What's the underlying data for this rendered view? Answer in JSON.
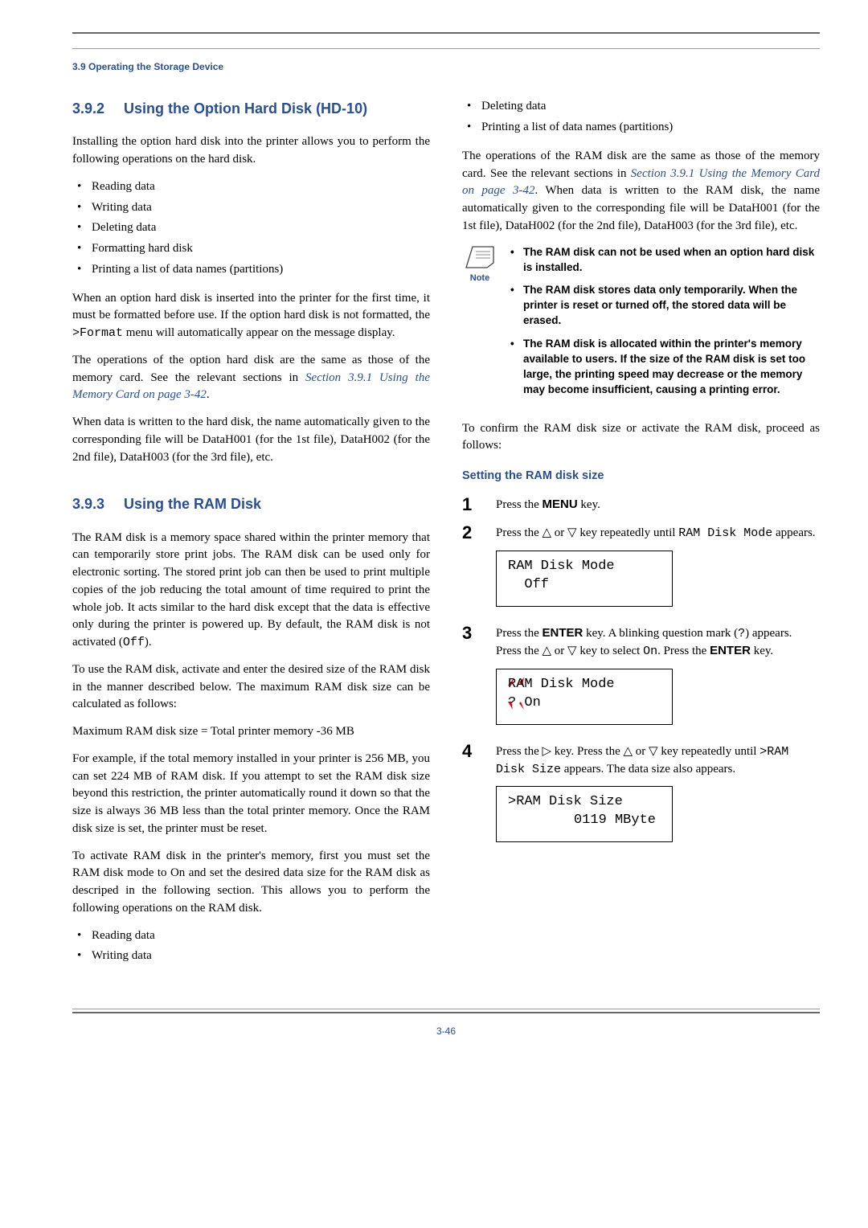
{
  "running_head": "3.9 Operating the Storage Device",
  "sect392": {
    "num": "3.9.2",
    "title": "Using the Option Hard Disk (HD-10)",
    "intro": "Installing the option hard disk into the printer allows you to perform the following operations on the hard disk.",
    "bullets": [
      "Reading data",
      "Writing data",
      "Deleting data",
      "Formatting hard disk",
      "Printing a list of data names (partitions)"
    ],
    "para2a": "When an option hard disk is inserted into the printer for the first time, it must be formatted before use. If the option hard disk is not formatted, the ",
    "format_code": ">Format",
    "para2b": " menu will automatically appear on the message display.",
    "para3a": "The operations of the option hard disk are the same as those of the memory card. See the relevant sections in ",
    "link1": "Section 3.9.1 Using the Memory Card on page 3-42",
    "para3b": ".",
    "para4": "When data is written to the hard disk, the name automatically given to the corresponding file will be DataH001 (for the 1st file), DataH002 (for the 2nd file), DataH003 (for the 3rd file), etc."
  },
  "sect393": {
    "num": "3.9.3",
    "title": "Using the RAM Disk",
    "para1a": "The RAM disk is a memory space shared within the printer memory that can temporarily store print jobs. The RAM disk can be used only for electronic sorting. The stored print job can then be used to print multiple copies of the job reducing the total amount of time required to print the whole job. It acts similar to the hard disk except that the data is effective only during the printer is powered up. By default, the RAM disk is not activated (",
    "off_code": "Off",
    "para1b": ").",
    "para2": "To use the RAM disk, activate and enter the desired size of the RAM disk in the manner described below. The maximum RAM disk size can be calculated as follows:",
    "formula": "Maximum RAM disk size = Total printer memory -36 MB",
    "para4": "For example, if the total memory installed in your printer is 256 MB, you can set 224 MB of RAM disk. If you attempt to set the RAM disk size beyond this restriction, the printer automatically round it down so that the size is always 36 MB less than the total printer memory. Once the RAM disk size is set, the printer must be reset.",
    "para5": "To activate RAM disk in the printer's memory, first you must set the RAM disk mode to On and set the desired data size for the RAM disk as descriped in the following section. This allows you to perform the following operations on the RAM disk.",
    "bullets2": [
      "Reading data",
      "Writing data"
    ]
  },
  "right": {
    "top_bullets": [
      "Deleting data",
      "Printing a list of data names (partitions)"
    ],
    "para1a": "The operations of the RAM disk are the same as those of the memory card. See the relevant sections in ",
    "link2": "Section 3.9.1 Using the Memory Card on page 3-42",
    "para1b": ". When data is written to the RAM disk, the name automatically given to the corresponding file will be DataH001 (for the 1st file), DataH002 (for the 2nd file), DataH003 (for the 3rd file), etc.",
    "note_label": "Note",
    "note_items": [
      "The RAM disk can not be used when an option hard disk is installed.",
      "The RAM disk stores data only temporarily. When the printer is reset or turned off, the stored data will be erased.",
      "The RAM disk is allocated within the printer's memory available to users. If the size of the RAM disk is set too large, the printing speed may decrease or the memory may become insufficient, causing a printing error."
    ],
    "para2": "To confirm the RAM disk size or activate the RAM disk, proceed as follows:",
    "subhead": "Setting the RAM disk size",
    "steps": {
      "s1a": "Press the ",
      "menu": "MENU",
      "s1b": " key.",
      "s2a": "Press the ",
      "up": "△",
      "or": " or ",
      "down": "▽",
      "s2b": " key repeatedly until ",
      "ramdisk": "RAM Disk Mode",
      "s2c": " appears.",
      "disp1_l1": "RAM Disk Mode",
      "disp1_l2": "Off",
      "s3a": "Press the ",
      "enter": "ENTER",
      "s3b": " key. A blinking question mark (",
      "q": "?",
      "s3c": ") appears. Press the ",
      "s3d": " key to select ",
      "on": "On",
      "s3e": ". Press the ",
      "s3f": " key.",
      "disp2_l1": "RAM Disk Mode",
      "disp2_l2": "? On",
      "s4a": "Press the ",
      "right": "▷",
      "s4b": " key. Press the ",
      "s4c": " key repeatedly until ",
      "ramsize": ">RAM Disk Size",
      "s4d": " appears. The data size also appears.",
      "disp3_l1": ">RAM Disk Size",
      "disp3_l2": "0119 MByte"
    }
  },
  "pagenum": "3-46"
}
